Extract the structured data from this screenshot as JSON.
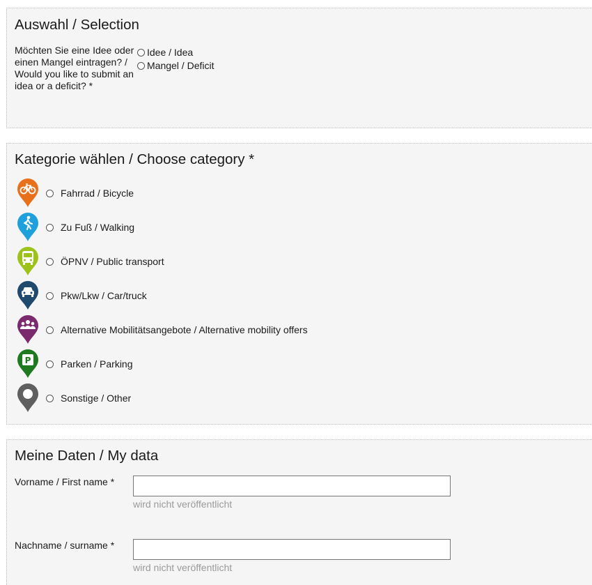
{
  "selection": {
    "title": "Auswahl / Selection",
    "question": "Möchten Sie eine Idee oder einen Mangel eintragen? / Would you like to submit an idea or a deficit? *",
    "options": [
      {
        "label": "Idee / Idea"
      },
      {
        "label": "Mangel / Deficit"
      }
    ]
  },
  "category": {
    "title": "Kategorie wählen / Choose category *",
    "options": [
      {
        "label": "Fahrrad / Bicycle",
        "icon": "bicycle-icon",
        "color": "#e8701a"
      },
      {
        "label": "Zu Fuß / Walking",
        "icon": "walking-icon",
        "color": "#1ea0dc"
      },
      {
        "label": "ÖPNV / Public transport",
        "icon": "bus-icon",
        "color": "#9dc31a"
      },
      {
        "label": "Pkw/Lkw / Car/truck",
        "icon": "car-icon",
        "color": "#1f4a6e"
      },
      {
        "label": "Alternative Mobilitätsangebote / Alternative mobility offers",
        "icon": "people-icon",
        "color": "#7b2a6e"
      },
      {
        "label": "Parken / Parking",
        "icon": "parking-icon",
        "color": "#1f7a1f"
      },
      {
        "label": "Sonstige / Other",
        "icon": "location-pin-icon",
        "color": "#5f5f5f"
      }
    ]
  },
  "mydata": {
    "title": "Meine Daten / My data",
    "fields": [
      {
        "label": "Vorname / First name *",
        "value": "",
        "hint": "wird nicht veröffentlicht"
      },
      {
        "label": "Nachname / surname *",
        "value": "",
        "hint": "wird nicht veröffentlicht"
      }
    ]
  }
}
